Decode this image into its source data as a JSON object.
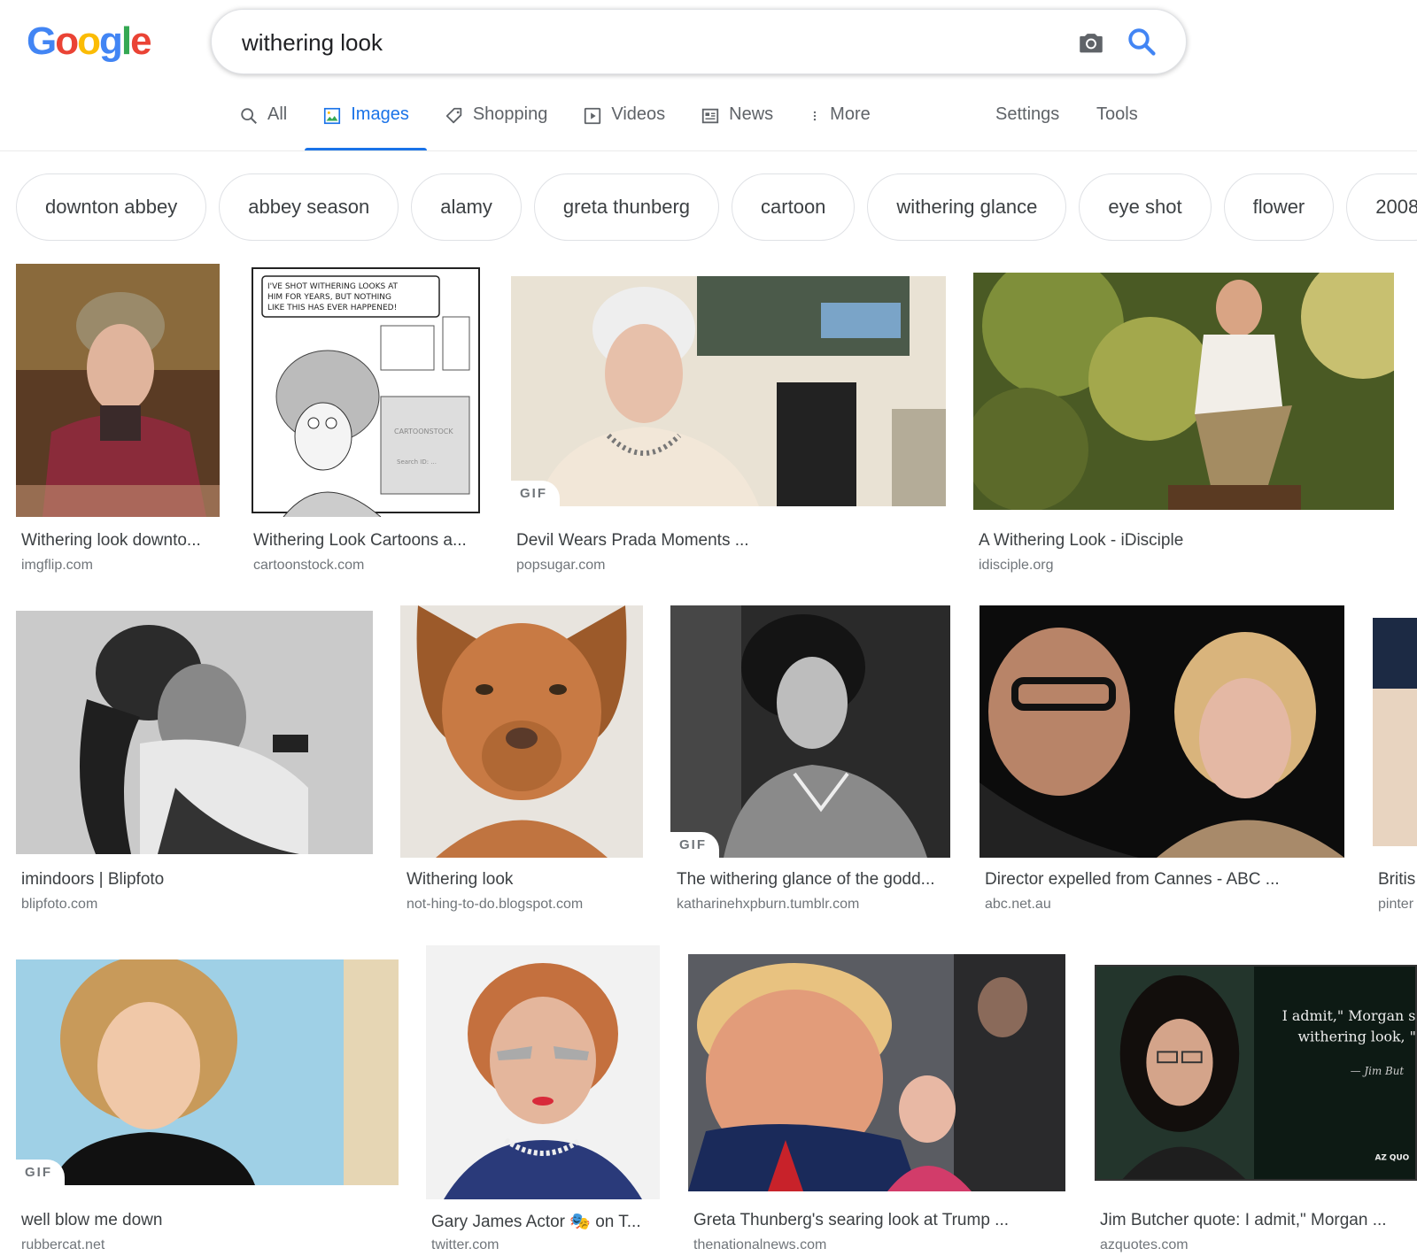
{
  "logo": {
    "letters": [
      "G",
      "o",
      "o",
      "g",
      "l",
      "e"
    ],
    "colors": [
      "#4285f4",
      "#ea4335",
      "#fbbc05",
      "#4285f4",
      "#34a853",
      "#ea4335"
    ]
  },
  "search": {
    "query": "withering look"
  },
  "tabs": [
    {
      "label": "All",
      "icon": "search-icon"
    },
    {
      "label": "Images",
      "icon": "image-icon",
      "active": true
    },
    {
      "label": "Shopping",
      "icon": "tag-icon"
    },
    {
      "label": "Videos",
      "icon": "play-icon"
    },
    {
      "label": "News",
      "icon": "news-icon"
    },
    {
      "label": "More",
      "icon": "more-vert-icon"
    }
  ],
  "tools": {
    "settings": "Settings",
    "tools": "Tools"
  },
  "chips": [
    "downton abbey",
    "abbey season",
    "alamy",
    "greta thunberg",
    "cartoon",
    "withering glance",
    "eye shot",
    "flower",
    "2008"
  ],
  "gif_label": "GIF",
  "results": [
    {
      "title": "Withering look downto...",
      "source": "imgflip.com"
    },
    {
      "title": "Withering Look Cartoons a...",
      "source": "cartoonstock.com"
    },
    {
      "title": "Devil Wears Prada Moments ...",
      "source": "popsugar.com"
    },
    {
      "title": "A Withering Look - iDisciple",
      "source": "idisciple.org"
    },
    {
      "title": "imindoors | Blipfoto",
      "source": "blipfoto.com"
    },
    {
      "title": "Withering look",
      "source": "not-hing-to-do.blogspot.com"
    },
    {
      "title": "The withering glance of the godd...",
      "source": "katharinehxpburn.tumblr.com"
    },
    {
      "title": "Director expelled from Cannes - ABC ...",
      "source": "abc.net.au"
    },
    {
      "title": "Britis",
      "source": "pinter"
    },
    {
      "title": "well blow me down",
      "source": "rubbercat.net"
    },
    {
      "title": "Gary James Actor 🎭 on T...",
      "source": "twitter.com"
    },
    {
      "title": "Greta Thunberg's searing look at Trump ...",
      "source": "thenationalnews.com"
    },
    {
      "title": "Jim Butcher quote: I admit,\" Morgan ...",
      "source": "azquotes.com"
    }
  ],
  "cartoon_caption": "I'VE SHOT WITHERING LOOKS AT HIM FOR YEARS, BUT NOTHING LIKE THIS HAS EVER HAPPENED!",
  "cartoon_watermark": "CARTOONSTOCK",
  "cartoon_search_id": "Search ID: ...",
  "quote_text": {
    "line1": "I admit,\" Morgan sa",
    "line2": "withering look, \"I",
    "author": "— Jim But",
    "logo": "AZ QUO"
  }
}
